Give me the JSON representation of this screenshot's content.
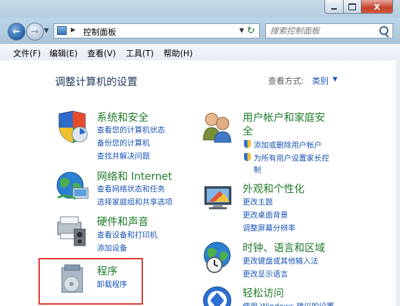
{
  "window": {
    "minimize_glyph": "",
    "maximize_glyph": "",
    "close_glyph": "x"
  },
  "nav": {
    "breadcrumb": "控制面板",
    "search_placeholder": "搜索控制面板"
  },
  "menu": [
    {
      "label": "文件(F)"
    },
    {
      "label": "编辑(E)"
    },
    {
      "label": "查看(V)"
    },
    {
      "label": "工具(T)"
    },
    {
      "label": "帮助(H)"
    }
  ],
  "page": {
    "title": "调整计算机的设置",
    "view_by_label": "查看方式:",
    "view_by_value": "类别"
  },
  "categories": {
    "system": {
      "title": "系统和安全",
      "links": [
        "查看您的计算机状态",
        "备份您的计算机",
        "查找并解决问题"
      ]
    },
    "network": {
      "title": "网络和 Internet",
      "links": [
        "查看网络状态和任务",
        "选择家庭组和共享选项"
      ]
    },
    "hardware": {
      "title": "硬件和声音",
      "links": [
        "查看设备和打印机",
        "添加设备"
      ]
    },
    "programs": {
      "title": "程序",
      "links": [
        "卸载程序"
      ]
    },
    "users": {
      "title_line1": "用户帐户和家庭安",
      "title_line2": "全",
      "links": [
        "添加或删除用户帐户",
        "为所有用户设置家长控",
        "制"
      ]
    },
    "appearance": {
      "title": "外观和个性化",
      "links": [
        "更改主题",
        "更改桌面背景",
        "调整屏幕分辨率"
      ]
    },
    "clock": {
      "title": "时钟、语言和区域",
      "links": [
        "更改键盘或其他输入法",
        "更改显示语言"
      ]
    },
    "access": {
      "title": "轻松访问",
      "links": [
        "使用 Windows 建议的设置"
      ]
    }
  },
  "colors": {
    "category_title": "#1e7a2a",
    "link": "#1a55b5",
    "highlight_border": "#e0322a"
  }
}
